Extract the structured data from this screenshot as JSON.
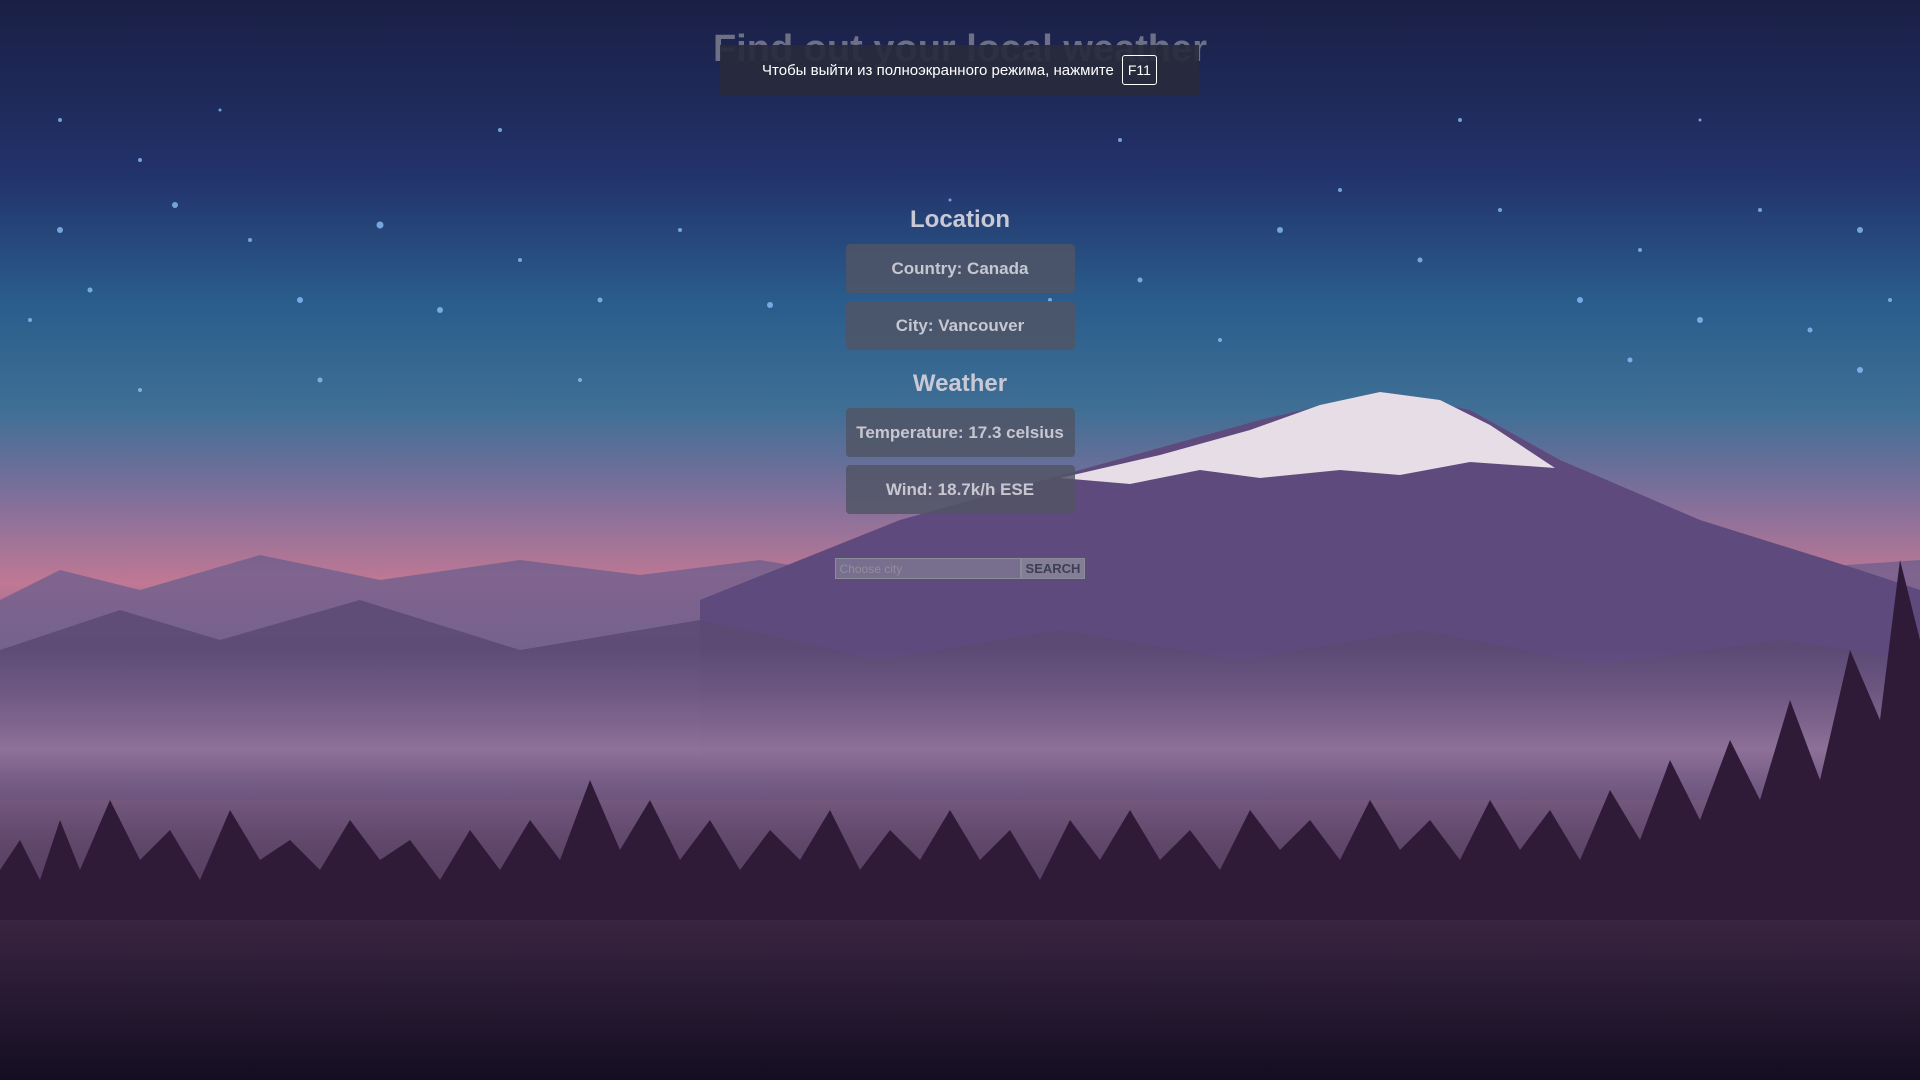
{
  "app": {
    "title": "Find out your local weather"
  },
  "fullscreen_notice": {
    "text": "Чтобы выйти из полноэкранного режима, нажмите",
    "key": "F11"
  },
  "location": {
    "heading": "Location",
    "country": "Country: Canada",
    "city": "City: Vancouver"
  },
  "weather": {
    "heading": "Weather",
    "temperature": "Temperature: 17.3 celsius",
    "wind": "Wind: 18.7k/h ESE"
  },
  "search": {
    "placeholder": "Choose city",
    "value": "",
    "button_label": "SEARCH"
  },
  "colors": {
    "sky_top": "#1a1f45",
    "sky_mid": "#2d5a8a",
    "horizon_pink": "#c87688",
    "mountain_purple": "#5f4a7a",
    "snow_cap": "#e6dde6",
    "forest": "#2f1a38"
  }
}
